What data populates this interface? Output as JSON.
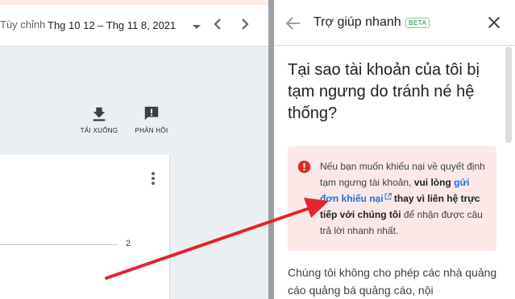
{
  "toolbar": {
    "range_label": "Tùy chỉnh",
    "date_range": "Thg 10 12 – Thg 11 8, 2021"
  },
  "actions": {
    "download_label": "TẢI XUỐNG",
    "feedback_label": "PHẢN HỒI"
  },
  "chart": {
    "axis_tick": "2"
  },
  "help_panel": {
    "title": "Trợ giúp nhanh",
    "badge": "BETA",
    "article_title": "Tại sao tài khoản của tôi bị tạm ngưng do tránh né hệ thống?",
    "callout": {
      "text_before": "Nếu bạn muốn khiếu nại về quyết định tạm ngưng tài khoản, ",
      "bold_1": "vui lòng",
      "link_text": "gửi đơn khiếu nại",
      "bold_2": " thay vì liên hệ trực tiếp với chúng tôi",
      "text_after": " để nhận được câu trả lời nhanh nhất."
    },
    "body_text": "Chúng tôi không cho phép các nhà quảng cáo quảng bá quảng cáo, nội"
  },
  "colors": {
    "link": "#1a73e8",
    "callout_bg": "#fce8e6",
    "alert_icon": "#d93025",
    "arrow": "#e3242b",
    "badge": "#188038"
  },
  "icons": {
    "back": "arrow-left-icon",
    "close": "close-icon",
    "download": "download-icon",
    "feedback": "feedback-icon",
    "alert": "error-circle-icon",
    "external": "external-link-icon"
  }
}
